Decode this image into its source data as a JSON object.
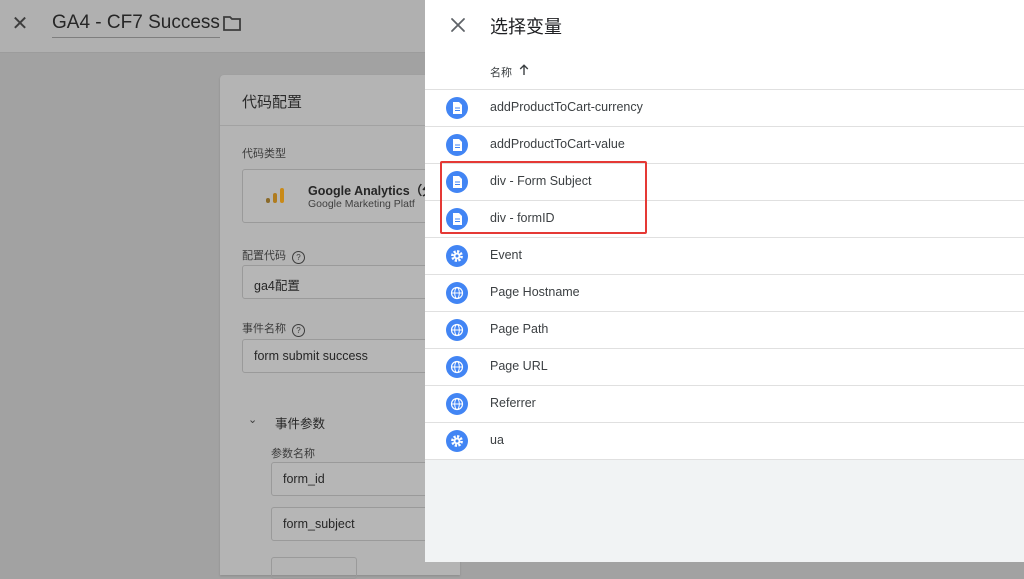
{
  "background": {
    "title": "GA4 - CF7 Success",
    "card_title": "代码配置",
    "tag_type_label": "代码类型",
    "tag_type_name": "Google Analytics（分",
    "tag_type_sub": "Google Marketing Platf",
    "config_tag_label": "配置代码",
    "config_tag_value": "ga4配置",
    "event_name_label": "事件名称",
    "event_name_value": "form submit success",
    "event_params_label": "事件参数",
    "param_name_label": "参数名称",
    "params": [
      "form_id",
      "form_subject"
    ]
  },
  "panel": {
    "title": "选择变量",
    "column_header": "名称",
    "variables": [
      {
        "name": "addProductToCart-currency",
        "icon": "document-icon"
      },
      {
        "name": "addProductToCart-value",
        "icon": "document-icon"
      },
      {
        "name": "div - Form Subject",
        "icon": "document-icon"
      },
      {
        "name": "div - formID",
        "icon": "document-icon"
      },
      {
        "name": "Event",
        "icon": "gear-icon"
      },
      {
        "name": "Page Hostname",
        "icon": "globe-icon"
      },
      {
        "name": "Page Path",
        "icon": "globe-icon"
      },
      {
        "name": "Page URL",
        "icon": "globe-icon"
      },
      {
        "name": "Referrer",
        "icon": "globe-icon"
      },
      {
        "name": "ua",
        "icon": "gear-icon"
      }
    ]
  },
  "colors": {
    "accent": "#4285f4",
    "highlight": "#e53935",
    "overlay": "#a2a2a2"
  }
}
